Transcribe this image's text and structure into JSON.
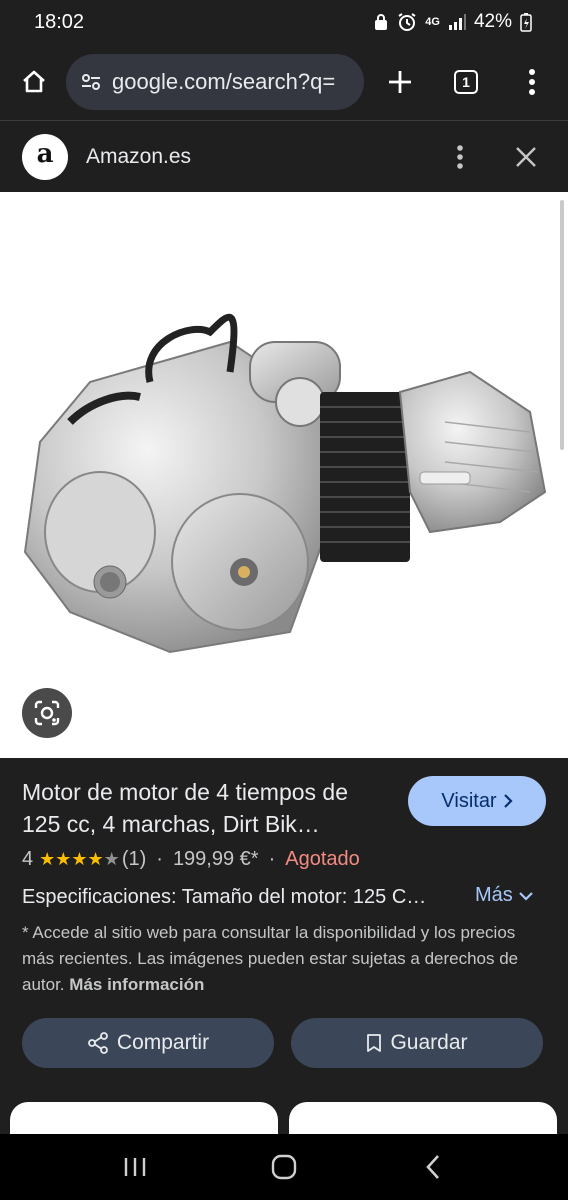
{
  "status": {
    "time": "18:02",
    "network": "4G",
    "battery": "42%"
  },
  "browser": {
    "url": "google.com/search?q=",
    "tab_count": "1"
  },
  "header": {
    "site_name": "Amazon.es",
    "logo_letter": "a"
  },
  "product": {
    "title": "Motor de motor de 4 tiempos de 125 cc, 4 marchas, Dirt Bik…",
    "visit_label": "Visitar",
    "rating": "4",
    "rating_stars": 4,
    "stars_filled": "★★★★",
    "stars_empty": "★",
    "review_count": "(1)",
    "separator": "·",
    "price": "199,99 €*",
    "availability": "Agotado",
    "specs": "Especificaciones: Tamaño del motor: 125 C…",
    "more_label": "Más",
    "disclaimer": "* Accede al sitio web para consultar la disponibilidad y los precios más recientes. Las imágenes pueden estar sujetas a derechos de autor.",
    "more_info": "Más información"
  },
  "actions": {
    "share_label": "Compartir",
    "save_label": "Guardar"
  },
  "colors": {
    "accent": "#a8c7fa",
    "star": "#fbbc04",
    "out_of_stock": "#f28b82"
  }
}
